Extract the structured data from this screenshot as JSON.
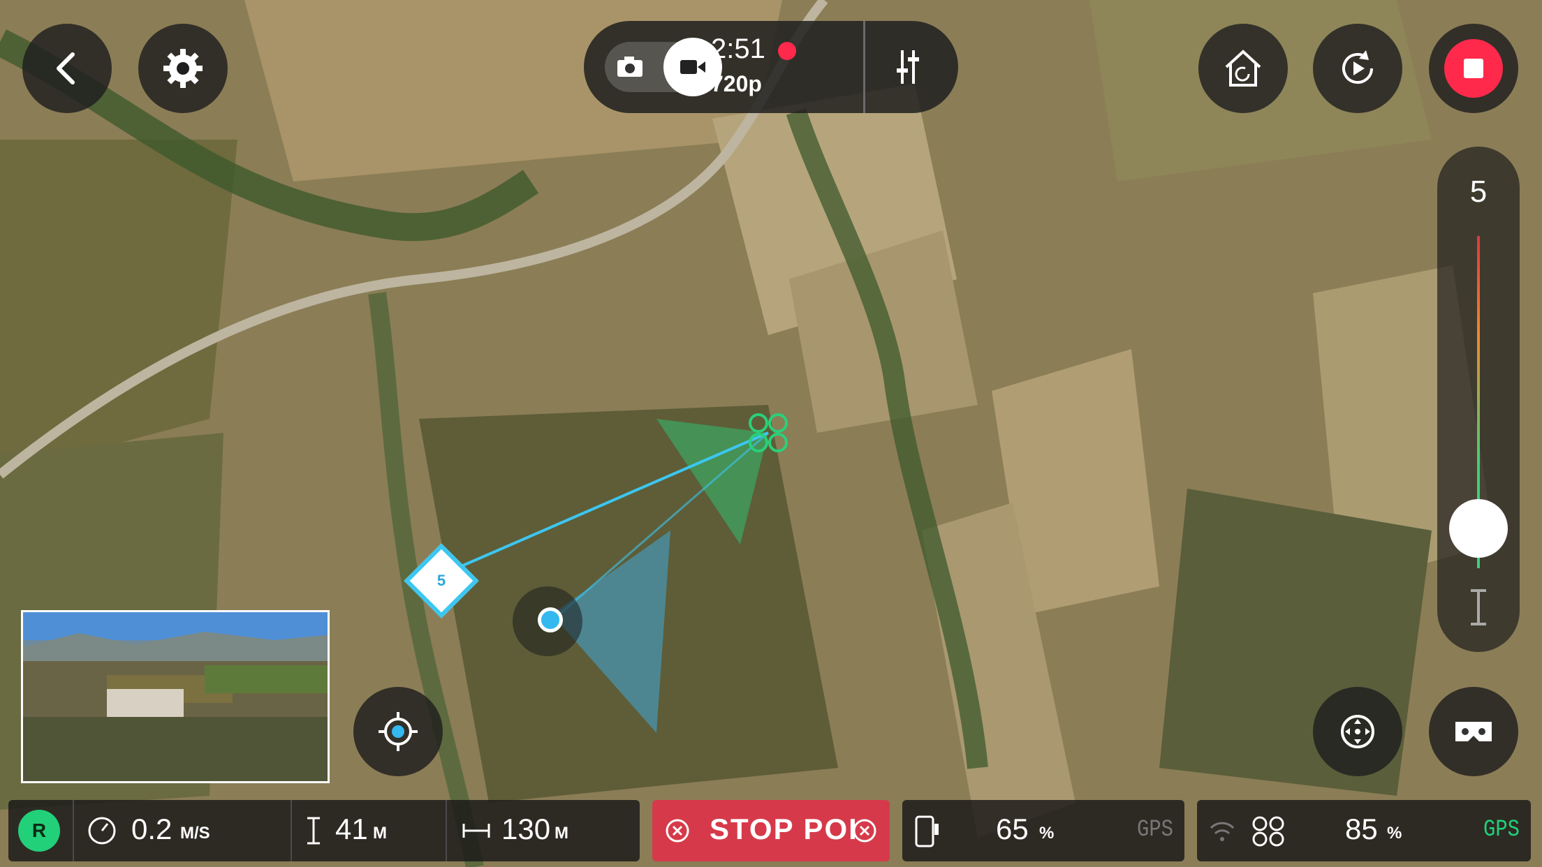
{
  "colors": {
    "accent_green": "#22d07a",
    "record_red": "#ff2a4b",
    "stop_red": "#d63a4a",
    "waypoint_blue": "#3cc7f0"
  },
  "top_left": {
    "back_icon": "chevron-left-icon",
    "settings_icon": "gear-icon"
  },
  "record_bar": {
    "time": "2:51",
    "resolution": "720p",
    "photo_icon": "camera-icon",
    "video_icon": "video-camera-icon",
    "settings_icon": "sliders-icon"
  },
  "top_right": {
    "home_icon": "return-home-icon",
    "replay_icon": "replay-icon",
    "stop_icon": "stop-icon"
  },
  "altitude": {
    "value": "5"
  },
  "waypoint": {
    "label": "5"
  },
  "stats": {
    "rth_badge": "R",
    "speed_value": "0.2",
    "speed_unit": "M/S",
    "altitude_value": "41",
    "altitude_unit": "M",
    "distance_value": "130",
    "distance_unit": "M"
  },
  "stop_poi": {
    "label": "STOP POI"
  },
  "phone": {
    "battery_value": "65",
    "battery_unit": "%",
    "gps_label": "GPS"
  },
  "drone": {
    "battery_value": "85",
    "battery_unit": "%",
    "gps_label": "GPS"
  },
  "bottom_right": {
    "recenter_icon": "move-icon",
    "vr_icon": "vr-goggles-icon"
  },
  "pip_icon": "camera-preview"
}
